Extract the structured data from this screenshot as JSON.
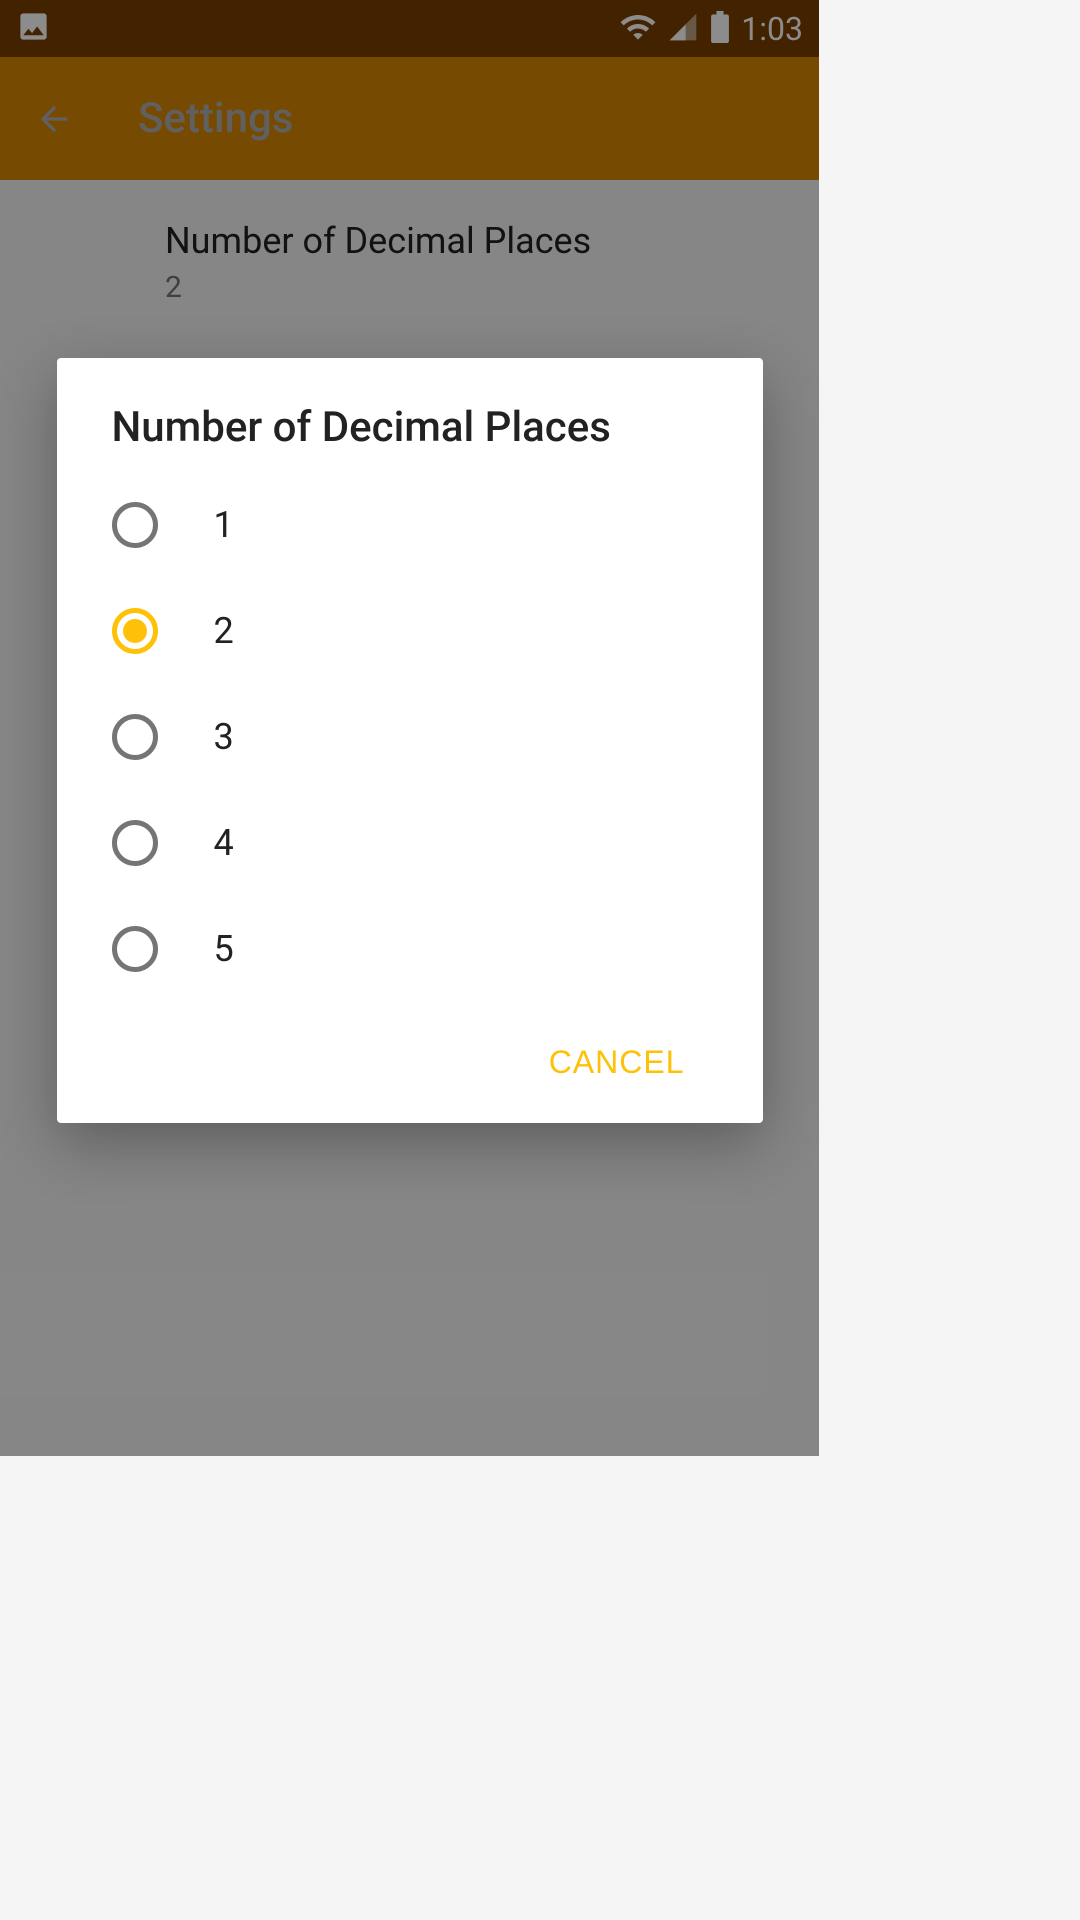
{
  "statusBar": {
    "time": "1:03"
  },
  "appBar": {
    "title": "Settings"
  },
  "setting": {
    "title": "Number of Decimal Places",
    "currentValue": "2"
  },
  "dialog": {
    "title": "Number of Decimal Places",
    "options": [
      {
        "label": "1",
        "selected": false
      },
      {
        "label": "2",
        "selected": true
      },
      {
        "label": "3",
        "selected": false
      },
      {
        "label": "4",
        "selected": false
      },
      {
        "label": "5",
        "selected": false
      }
    ],
    "cancel": "CANCEL"
  }
}
